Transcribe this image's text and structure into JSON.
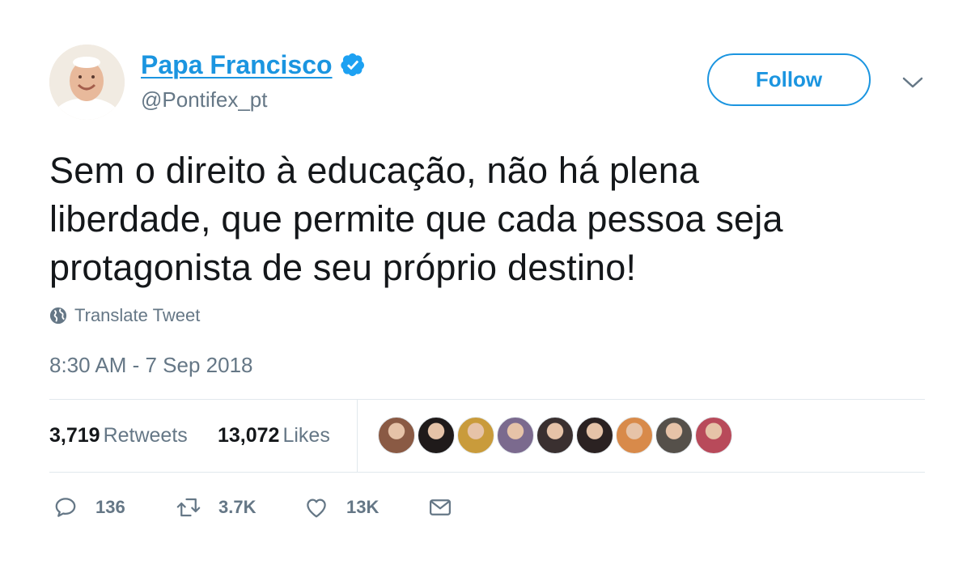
{
  "author": {
    "display_name": "Papa Francisco",
    "handle": "@Pontifex_pt",
    "verified": true,
    "avatar_icon": "pope-portrait-avatar"
  },
  "follow": {
    "label": "Follow"
  },
  "tweet": {
    "text": "Sem o direito à educação, não há plena\nliberdade, que permite que cada pessoa seja\nprotagonista de seu próprio destino!",
    "translate_label": "Translate Tweet",
    "timestamp": "8:30 AM - 7 Sep 2018"
  },
  "stats": {
    "retweets_count": "3,719",
    "retweets_label": "Retweets",
    "likes_count": "13,072",
    "likes_label": "Likes"
  },
  "likers": [
    {
      "color": "#8a5a44"
    },
    {
      "color": "#1f1a1a"
    },
    {
      "color": "#c99b3b"
    },
    {
      "color": "#7b6a8e"
    },
    {
      "color": "#3a3030"
    },
    {
      "color": "#2b2222"
    },
    {
      "color": "#d88a4a"
    },
    {
      "color": "#55504a"
    },
    {
      "color": "#b84a5a"
    }
  ],
  "actions": {
    "reply_count": "136",
    "retweet_count": "3.7K",
    "like_count": "13K"
  },
  "colors": {
    "accent": "#1b95e0",
    "text": "#14171a",
    "secondary": "#657786",
    "divider": "#e1e8ed"
  }
}
